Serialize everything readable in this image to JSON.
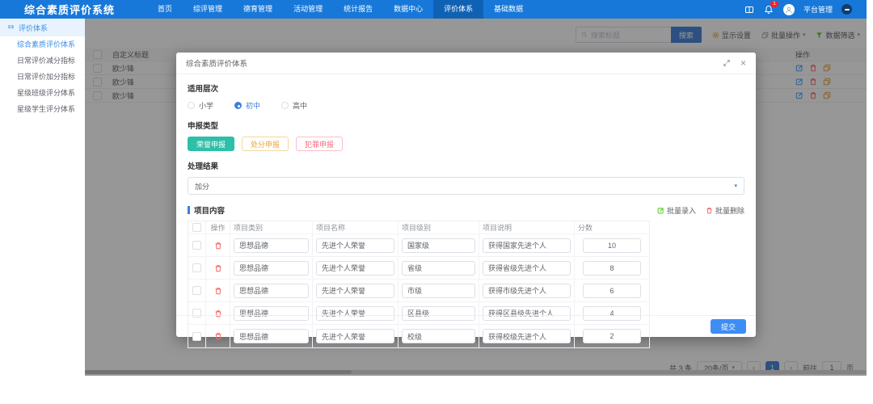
{
  "navbar": {
    "brand": "综合素质评价系统",
    "items": [
      "首页",
      "综评管理",
      "德育管理",
      "活动管理",
      "统计报告",
      "数据中心",
      "评价体系",
      "基础数据"
    ],
    "active_item": "评价体系",
    "notification_badge": "1",
    "user_name": "平台管理"
  },
  "sidebar": {
    "root_item": "评价体系",
    "items": [
      "综合素质评价体系",
      "日常评价减分指标",
      "日常评价加分指标",
      "星级班级评分体系",
      "星级学生评分体系"
    ],
    "active_item": "综合素质评价体系"
  },
  "toolbar": {
    "search_placeholder": "搜索标题",
    "search_button": "搜索",
    "display_settings": "显示设置",
    "batch_actions": "批量操作",
    "data_filter": "数据筛选"
  },
  "background_table": {
    "title_header": "自定义标题",
    "action_header": "操作",
    "rows": [
      "欧少锋",
      "欧少锋",
      "欧少锋"
    ]
  },
  "modal": {
    "title": "综合素质评价体系",
    "level_label": "适用层次",
    "levels": [
      "小学",
      "初中",
      "高中"
    ],
    "selected_level": "初中",
    "type_label": "申报类型",
    "types": [
      "荣誉申报",
      "处分申报",
      "犯罪申报"
    ],
    "selected_type": "荣誉申报",
    "result_label": "处理结果",
    "result_value": "加分",
    "content_label": "项目内容",
    "batch_import": "批量录入",
    "batch_delete": "批量删除",
    "table": {
      "headers": [
        "操作",
        "项目类别",
        "项目名称",
        "项目级别",
        "项目说明",
        "分数"
      ],
      "rows": [
        {
          "category": "思想品德",
          "name": "先进个人荣誉",
          "level": "国家级",
          "desc": "获得国家先进个人",
          "score": "10"
        },
        {
          "category": "思想品德",
          "name": "先进个人荣誉",
          "level": "省级",
          "desc": "获得省级先进个人",
          "score": "8"
        },
        {
          "category": "思想品德",
          "name": "先进个人荣誉",
          "level": "市级",
          "desc": "获得市级先进个人",
          "score": "6"
        },
        {
          "category": "思想品德",
          "name": "先进个人荣誉",
          "level": "区县级",
          "desc": "获得区县级先进个人",
          "score": "4"
        },
        {
          "category": "思想品德",
          "name": "先进个人荣誉",
          "level": "校级",
          "desc": "获得校级先进个人",
          "score": "2"
        }
      ]
    },
    "submit_button": "提交"
  },
  "pagination": {
    "total": "共 3 条",
    "page_size": "20条/页",
    "current_page": "1",
    "goto_label": "前往",
    "goto_value": "1",
    "goto_unit": "页"
  },
  "colors": {
    "navbar_blue": "#1778d9",
    "accent_blue": "#3d7fd9",
    "teal": "#2dbfa7",
    "orange": "#eda23c",
    "red": "#f56c6c",
    "green": "#52c41a"
  },
  "icons": {
    "search": "magnifier",
    "display_settings": "gear",
    "batch_actions": "copy",
    "data_filter": "funnel",
    "notification": "bell",
    "layout": "split-window",
    "user": "person",
    "expand": "diagonal-arrows",
    "close": "×",
    "dropdown": "▾",
    "edit": "pencil-square",
    "delete": "trash",
    "copy": "duplicate"
  }
}
